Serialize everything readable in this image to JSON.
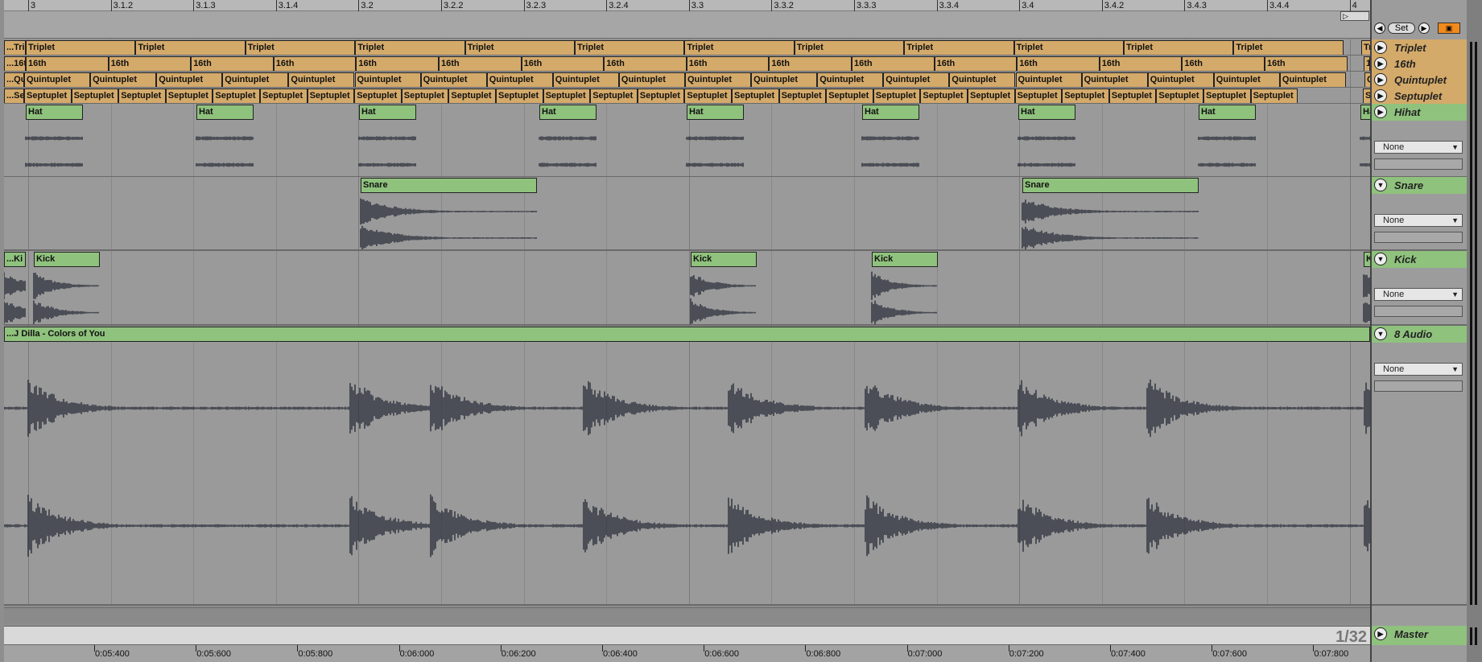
{
  "ruler": {
    "labels": [
      "3",
      "3.1.2",
      "3.1.3",
      "3.1.4",
      "3.2",
      "3.2.2",
      "3.2.3",
      "3.2.4",
      "3.3",
      "3.3.2",
      "3.3.3",
      "3.3.4",
      "3.4",
      "3.4.2",
      "3.4.3",
      "3.4.4",
      "4"
    ]
  },
  "controls": {
    "set_label": "Set",
    "prev_icon": "left-arrow-icon",
    "next_icon": "right-arrow-icon",
    "lock_icon": "lock-icon",
    "loop_icon": "loop-brace-icon"
  },
  "tracks": [
    {
      "name": "Triplet",
      "kind": "orange",
      "clips": [
        {
          "label": "...Tri"
        },
        {
          "label": "Triplet"
        },
        {
          "label": "Triplet"
        },
        {
          "label": "Triplet"
        },
        {
          "label": "Triplet"
        },
        {
          "label": "Triplet"
        },
        {
          "label": "Triplet"
        },
        {
          "label": "Triplet"
        },
        {
          "label": "Triplet"
        },
        {
          "label": "Triplet"
        },
        {
          "label": "Triplet"
        },
        {
          "label": "Triplet"
        },
        {
          "label": "Triplet"
        },
        {
          "label": "Tr"
        }
      ]
    },
    {
      "name": "16th",
      "kind": "orange",
      "clips": [
        {
          "label": "...16t"
        },
        {
          "label": "16th"
        },
        {
          "label": "16th"
        },
        {
          "label": "16th"
        },
        {
          "label": "16th"
        },
        {
          "label": "16th"
        },
        {
          "label": "16th"
        },
        {
          "label": "16th"
        },
        {
          "label": "16th"
        },
        {
          "label": "16th"
        },
        {
          "label": "16th"
        },
        {
          "label": "16th"
        },
        {
          "label": "16th"
        },
        {
          "label": "16th"
        },
        {
          "label": "16th"
        },
        {
          "label": "16th"
        },
        {
          "label": "16th"
        },
        {
          "label": "16"
        }
      ]
    },
    {
      "name": "Quintuplet",
      "kind": "orange",
      "clips": [
        {
          "label": "...Qu"
        },
        {
          "label": "Quintuplet"
        },
        {
          "label": "Quintuplet"
        },
        {
          "label": "Quintuplet"
        },
        {
          "label": "Quintuplet"
        },
        {
          "label": "Quintuplet"
        },
        {
          "label": "Quintuplet"
        },
        {
          "label": "Quintuplet"
        },
        {
          "label": "Quintuplet"
        },
        {
          "label": "Quintuplet"
        },
        {
          "label": "Quintuplet"
        },
        {
          "label": "Quintuplet"
        },
        {
          "label": "Quintuplet"
        },
        {
          "label": "Quintuplet"
        },
        {
          "label": "Quintuplet"
        },
        {
          "label": "Quintuplet"
        },
        {
          "label": "Quintuplet"
        },
        {
          "label": "Quintuplet"
        },
        {
          "label": "Quintuplet"
        },
        {
          "label": "Quintuplet"
        },
        {
          "label": "Quintuplet"
        },
        {
          "label": "Qu"
        }
      ]
    },
    {
      "name": "Septuplet",
      "kind": "orange",
      "clips": [
        {
          "label": "...Se"
        },
        {
          "label": "Septuplet"
        },
        {
          "label": "Septuplet"
        },
        {
          "label": "Septuplet"
        },
        {
          "label": "Septuplet"
        },
        {
          "label": "Septuplet"
        },
        {
          "label": "Septuplet"
        },
        {
          "label": "Septuplet"
        },
        {
          "label": "Septuplet"
        },
        {
          "label": "Septuplet"
        },
        {
          "label": "Septuplet"
        },
        {
          "label": "Septuplet"
        },
        {
          "label": "Septuplet"
        },
        {
          "label": "Septuplet"
        },
        {
          "label": "Septuplet"
        },
        {
          "label": "Septuplet"
        },
        {
          "label": "Septuplet"
        },
        {
          "label": "Septuplet"
        },
        {
          "label": "Septuplet"
        },
        {
          "label": "Septuplet"
        },
        {
          "label": "Septuplet"
        },
        {
          "label": "Septuplet"
        },
        {
          "label": "Septuplet"
        },
        {
          "label": "Septuplet"
        },
        {
          "label": "Septuplet"
        },
        {
          "label": "Septuplet"
        },
        {
          "label": "Septuplet"
        },
        {
          "label": "Septuplet"
        },
        {
          "label": "Se"
        }
      ]
    },
    {
      "name": "Hihat",
      "kind": "green",
      "input": "None",
      "clips": [
        {
          "label": "Hat"
        },
        {
          "label": "Hat"
        },
        {
          "label": "Hat"
        },
        {
          "label": "Hat"
        },
        {
          "label": "Hat"
        },
        {
          "label": "Hat"
        },
        {
          "label": "Hat"
        },
        {
          "label": "Hat"
        },
        {
          "label": "Ha"
        }
      ]
    },
    {
      "name": "Snare",
      "kind": "green",
      "input": "None",
      "clips": [
        {
          "label": "Snare"
        },
        {
          "label": "Snare"
        }
      ]
    },
    {
      "name": "Kick",
      "kind": "green",
      "input": "None",
      "clips": [
        {
          "label": "...Ki"
        },
        {
          "label": "Kick"
        },
        {
          "label": "Kick"
        },
        {
          "label": "Kick"
        },
        {
          "label": "K"
        }
      ]
    },
    {
      "name": "8 Audio",
      "kind": "green",
      "input": "None",
      "clips": [
        {
          "label": "...J Dilla - Colors of You"
        }
      ]
    }
  ],
  "master": {
    "name": "Master",
    "zoom": "1/32"
  },
  "time_ruler": {
    "labels": [
      "0:05:400",
      "0:05:600",
      "0:05:800",
      "0:06:000",
      "0:06:200",
      "0:06:400",
      "0:06:600",
      "0:06:800",
      "0:07:000",
      "0:07:200",
      "0:07:400",
      "0:07:600",
      "0:07:800"
    ]
  },
  "colors": {
    "clip_orange": "#d4aa6a",
    "clip_green": "#8fc27d",
    "waveform": "#2a2d3a",
    "accent_orange": "#f08a1c"
  }
}
